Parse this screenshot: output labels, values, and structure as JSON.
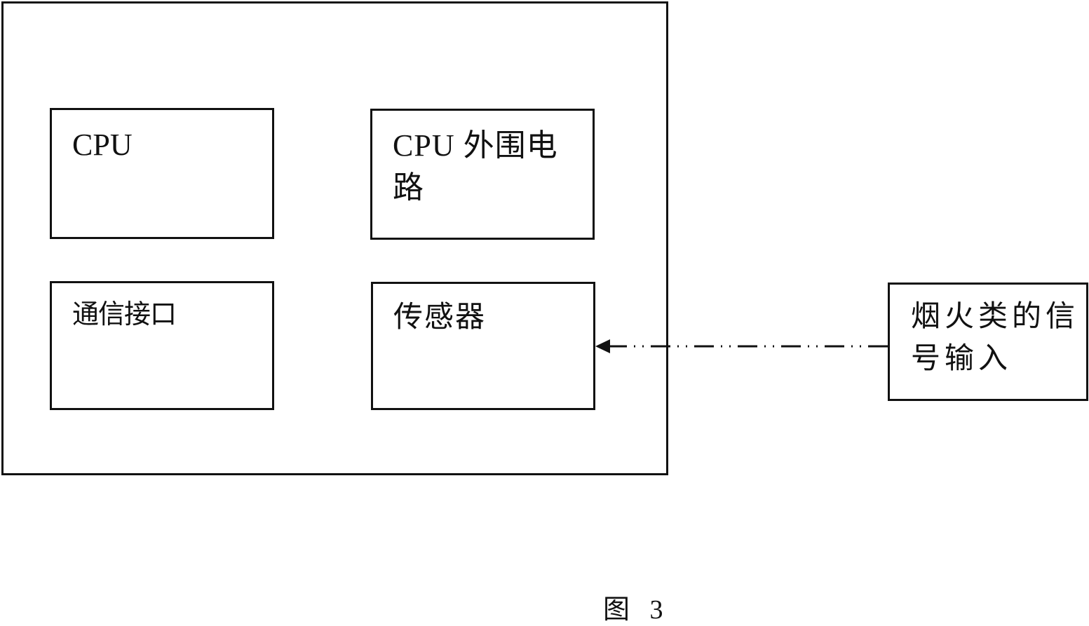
{
  "diagram": {
    "title": "Figure 3 block diagram",
    "device_blocks": [
      {
        "id": "cpu",
        "label": "CPU"
      },
      {
        "id": "cpu_peripheral",
        "label": "CPU 外围电路"
      },
      {
        "id": "comm_interface",
        "label": "通信接口"
      },
      {
        "id": "sensor",
        "label": "传感器"
      }
    ],
    "external_block": {
      "id": "signal_input",
      "label": "烟火类的信号输入"
    },
    "connections": [
      {
        "from": "signal_input",
        "to": "sensor",
        "style": "dash-dot",
        "arrow": "end"
      }
    ],
    "caption": {
      "prefix": "图",
      "number": "3"
    }
  }
}
